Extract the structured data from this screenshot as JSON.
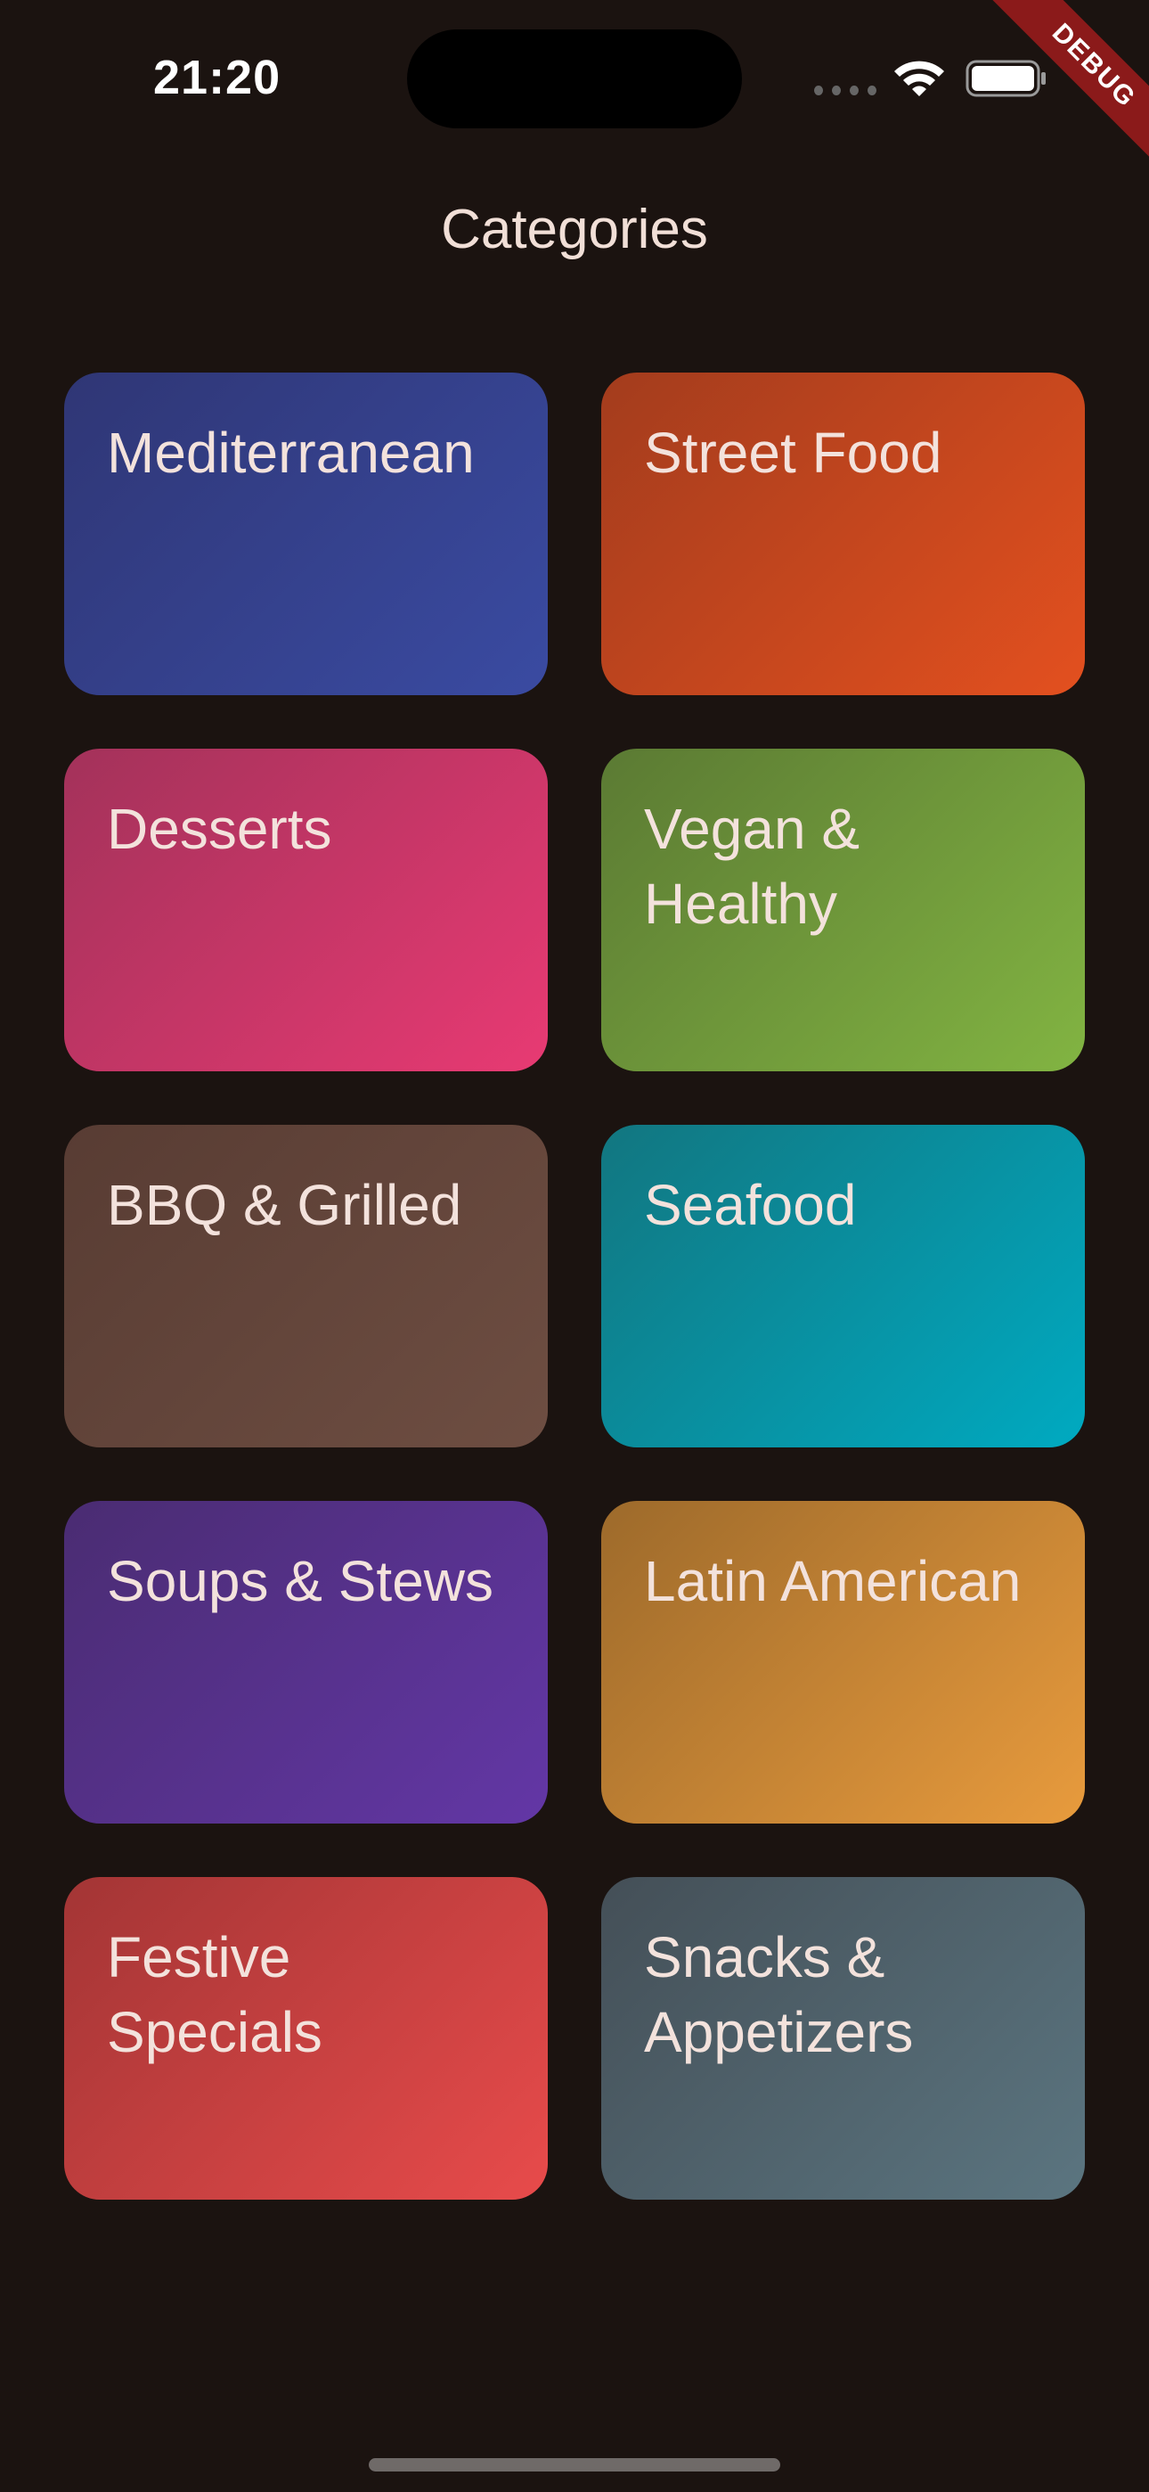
{
  "status_bar": {
    "time": "21:20",
    "icons": [
      "cellular-icon",
      "wifi-icon",
      "battery-icon"
    ]
  },
  "debug_banner": {
    "label": "DEBUG",
    "color": "#8b1a1a"
  },
  "page": {
    "title": "Categories"
  },
  "categories": [
    {
      "label": "Mediterranean",
      "color_from": "#2f3675",
      "color_to": "#3a4ba2"
    },
    {
      "label": "Street Food",
      "color_from": "#a33c1d",
      "color_to": "#e3501f"
    },
    {
      "label": "Desserts",
      "color_from": "#a3325a",
      "color_to": "#e83a73"
    },
    {
      "label": "Vegan & Healthy",
      "color_from": "#5b7a33",
      "color_to": "#82b442"
    },
    {
      "label": "BBQ & Grilled",
      "color_from": "#583c33",
      "color_to": "#6e4e42"
    },
    {
      "label": "Seafood",
      "color_from": "#127680",
      "color_to": "#00aac1"
    },
    {
      "label": "Soups & Stews",
      "color_from": "#4a2c72",
      "color_to": "#6337a6"
    },
    {
      "label": "Latin American",
      "color_from": "#9d6a2b",
      "color_to": "#e89b3d"
    },
    {
      "label": "Festive Specials",
      "color_from": "#a33535",
      "color_to": "#e84b4b"
    },
    {
      "label": "Snacks & Appetizers",
      "color_from": "#444f57",
      "color_to": "#5b7580"
    }
  ]
}
